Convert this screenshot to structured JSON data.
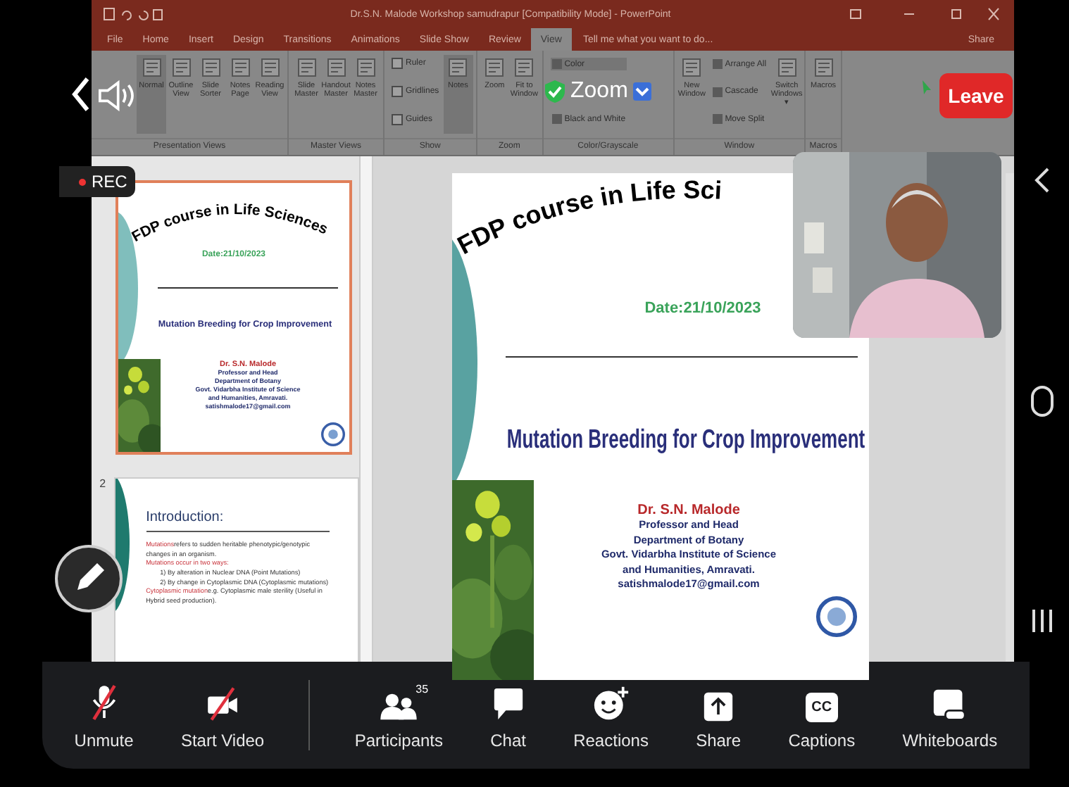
{
  "powerpoint": {
    "title": "Dr.S.N. Malode Workshop samudrapur [Compatibility Mode] - PowerPoint",
    "tabs": [
      {
        "label": "File",
        "selected": false
      },
      {
        "label": "Home",
        "selected": false
      },
      {
        "label": "Insert",
        "selected": false
      },
      {
        "label": "Design",
        "selected": false
      },
      {
        "label": "Transitions",
        "selected": false
      },
      {
        "label": "Animations",
        "selected": false
      },
      {
        "label": "Slide Show",
        "selected": false
      },
      {
        "label": "Review",
        "selected": false
      },
      {
        "label": "View",
        "selected": true
      }
    ],
    "tell_me": "Tell me what you want to do...",
    "share": "Share",
    "ribbon": [
      {
        "label": "Presentation Views",
        "items": [
          {
            "kind": "button",
            "label": "Normal",
            "selected": true
          },
          {
            "kind": "button",
            "label": "Outline View",
            "selected": false
          },
          {
            "kind": "button",
            "label": "Slide Sorter",
            "selected": false
          },
          {
            "kind": "button",
            "label": "Notes Page",
            "selected": false
          },
          {
            "kind": "button",
            "label": "Reading View",
            "selected": false
          }
        ]
      },
      {
        "label": "Master Views",
        "items": [
          {
            "kind": "button",
            "label": "Slide Master",
            "selected": false
          },
          {
            "kind": "button",
            "label": "Handout Master",
            "selected": false
          },
          {
            "kind": "button",
            "label": "Notes Master",
            "selected": false
          }
        ]
      },
      {
        "label": "Show",
        "items": [
          {
            "kind": "checks",
            "checks": [
              {
                "label": "Ruler",
                "checked": false
              },
              {
                "label": "Gridlines",
                "checked": false
              },
              {
                "label": "Guides",
                "checked": false
              }
            ]
          },
          {
            "kind": "button",
            "label": "Notes",
            "selected": true
          }
        ]
      },
      {
        "label": "Zoom",
        "items": [
          {
            "kind": "button",
            "label": "Zoom",
            "selected": false
          },
          {
            "kind": "button",
            "label": "Fit to Window",
            "selected": false
          }
        ]
      },
      {
        "label": "Color/Grayscale",
        "items": [
          {
            "kind": "smalls",
            "smalls": [
              {
                "label": "Color",
                "selected": true
              },
              {
                "label": "Black and White",
                "selected": false
              }
            ]
          }
        ]
      },
      {
        "label": "Window",
        "items": [
          {
            "kind": "button",
            "label": "New Window",
            "selected": false
          },
          {
            "kind": "smalls",
            "smalls": [
              {
                "label": "Arrange All",
                "selected": false
              },
              {
                "label": "Cascade",
                "selected": false
              },
              {
                "label": "Move Split",
                "selected": false
              }
            ]
          },
          {
            "kind": "button",
            "label": "Switch Windows ▾",
            "selected": false
          }
        ]
      },
      {
        "label": "Macros",
        "items": [
          {
            "kind": "button",
            "label": "Macros",
            "selected": false
          }
        ]
      }
    ],
    "thumbnails": [
      {
        "kind": "title",
        "selected": true,
        "title": "FDP course in Life Sciences",
        "date": "Date:21/10/2023",
        "heading": "Mutation Breeding for Crop Improvement",
        "author": "Dr. S.N. Malode",
        "lines": [
          "Professor and Head",
          "Department of Botany",
          "Govt. Vidarbha Institute of Science",
          "and Humanities, Amravati.",
          "satishmalode17@gmail.com"
        ]
      },
      {
        "kind": "intro",
        "selected": false,
        "number": "2",
        "heading": "Introduction:",
        "bullets": [
          {
            "lead": "Mutations",
            "text": "refers to sudden heritable phenotypic/genotypic changes in an organism."
          },
          {
            "lead": "Mutations occur in two ways:",
            "children": [
              "1) By alteration in Nuclear DNA (Point Mutations)",
              "2) By change in Cytoplasmic DNA (Cytoplasmic mutations)"
            ]
          },
          {
            "lead": "Cytoplasmic mutation",
            "text": "e.g. Cytoplasmic male sterility (Useful in Hybrid seed production)."
          }
        ]
      }
    ],
    "main_slide": {
      "title": "FDP course in Life Sci",
      "date": "Date:21/10/2023",
      "heading": "Mutation Breeding for Crop Improvement",
      "author": "Dr. S.N. Malode",
      "lines": [
        "Professor and Head",
        "Department of Botany",
        "Govt. Vidarbha Institute of Science",
        "and Humanities, Amravati.",
        "satishmalode17@gmail.com"
      ]
    }
  },
  "meeting": {
    "share_menu": "Zoom",
    "leave": "Leave",
    "recording": "REC"
  },
  "toolbar": [
    {
      "kind": "mic",
      "label": "Unmute",
      "off": true
    },
    {
      "kind": "video",
      "label": "Start Video",
      "off": true
    },
    {
      "kind": "participants",
      "label": "Participants",
      "badge": "35"
    },
    {
      "kind": "chat",
      "label": "Chat"
    },
    {
      "kind": "reactions",
      "label": "Reactions"
    },
    {
      "kind": "share",
      "label": "Share"
    },
    {
      "kind": "captions",
      "label": "Captions",
      "icon_text": "CC"
    },
    {
      "kind": "whiteboard",
      "label": "Whiteboards"
    }
  ]
}
